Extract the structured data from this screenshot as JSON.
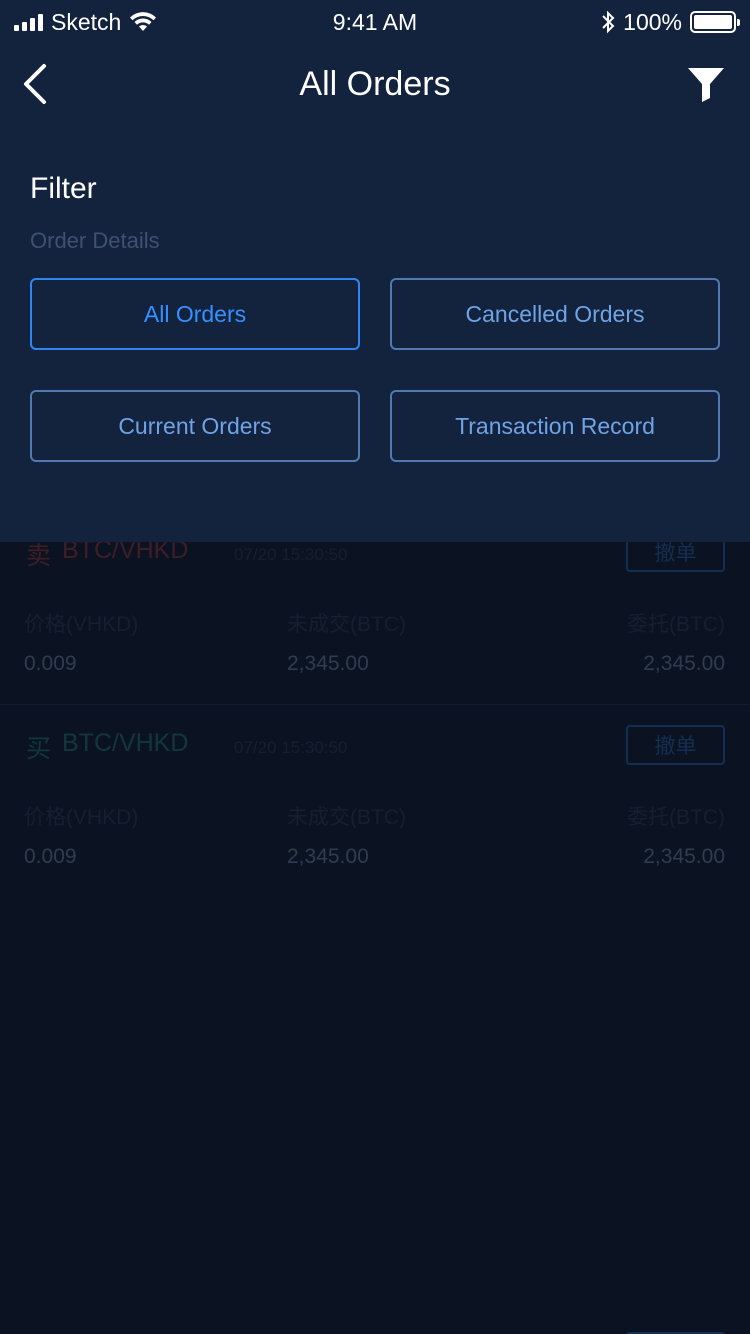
{
  "status_bar": {
    "carrier": "Sketch",
    "time": "9:41 AM",
    "battery": "100%"
  },
  "nav": {
    "title": "All Orders"
  },
  "filter": {
    "heading": "Filter",
    "section_label": "Order Details",
    "options": [
      {
        "label": "All Orders",
        "active": true
      },
      {
        "label": "Cancelled Orders",
        "active": false
      },
      {
        "label": "Current Orders",
        "active": false
      },
      {
        "label": "Transaction Record",
        "active": false
      }
    ]
  },
  "orders": [
    {
      "side": "卖",
      "pair": "BTC/VHKD",
      "time": "07/20 15:30:50",
      "cancel_label": "撤单",
      "columns": [
        {
          "label": "价格(VHKD)",
          "value": "0.009"
        },
        {
          "label": "未成交(BTC)",
          "value": "2,345.00"
        },
        {
          "label": "委托(BTC)",
          "value": "2,345.00"
        }
      ]
    },
    {
      "side": "买",
      "pair": "BTC/VHKD",
      "time": "07/20 15:30:50",
      "cancel_label": "撤单",
      "columns": [
        {
          "label": "价格(VHKD)",
          "value": "0.009"
        },
        {
          "label": "未成交(BTC)",
          "value": "2,345.00"
        },
        {
          "label": "委托(BTC)",
          "value": "2,345.00"
        }
      ]
    }
  ],
  "colors": {
    "background": "#0e1828",
    "panel": "#13233d",
    "accent": "#3690ff",
    "sell": "#6a2a30",
    "buy": "#1b5a55"
  }
}
